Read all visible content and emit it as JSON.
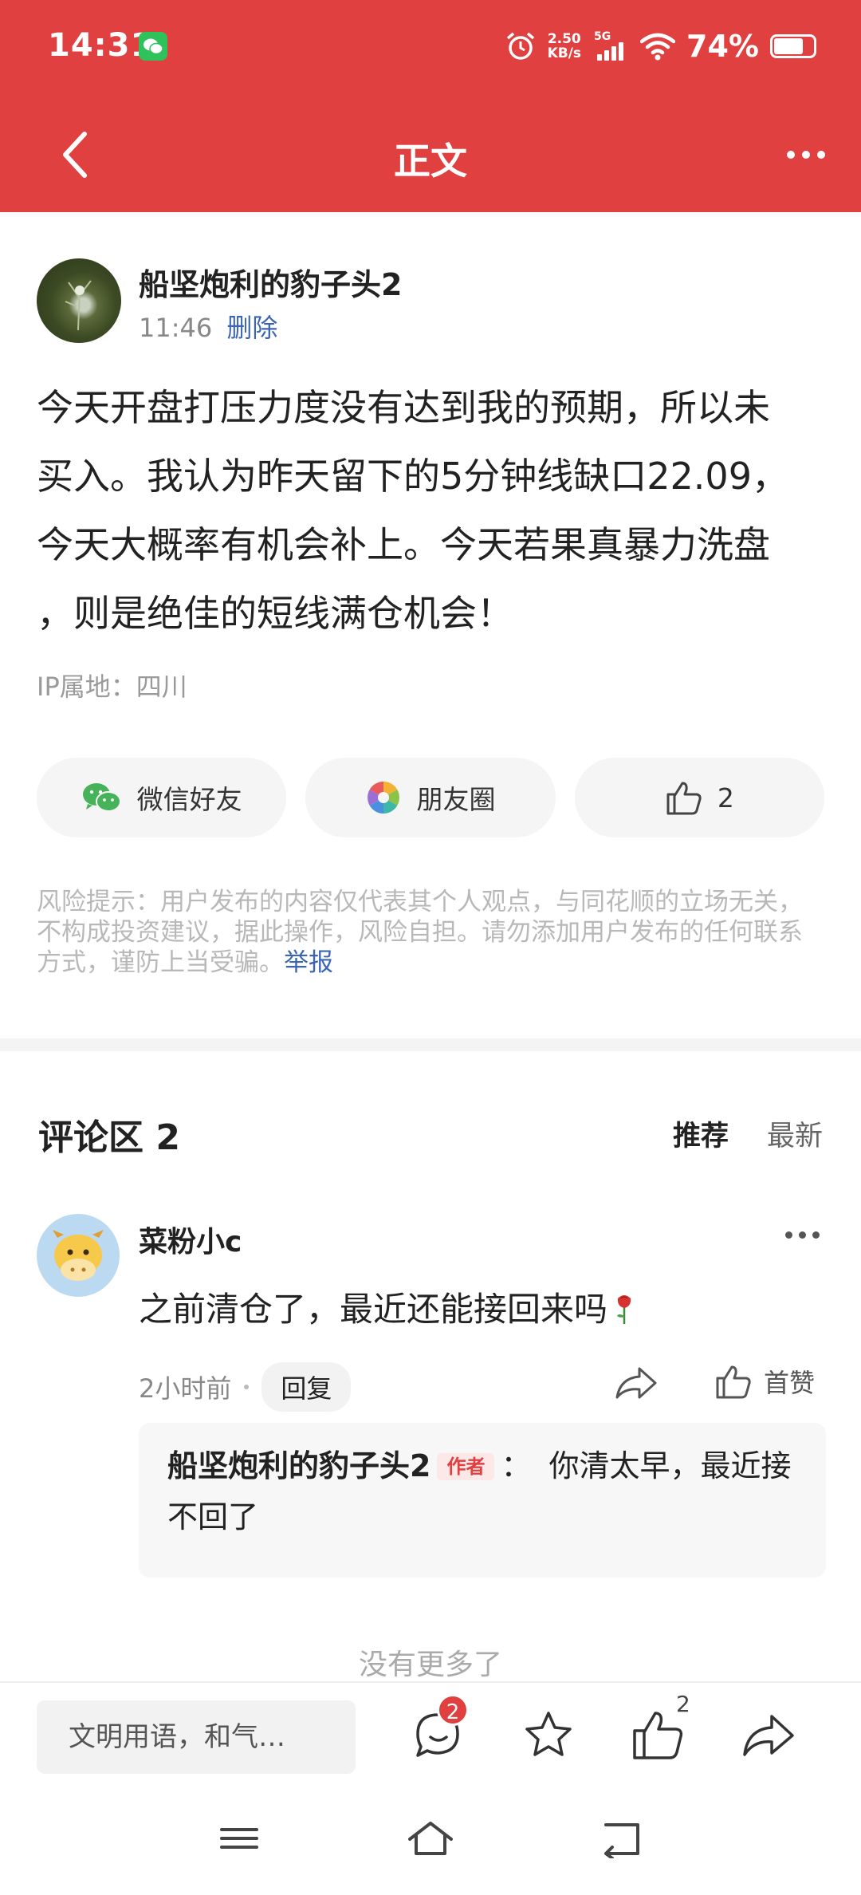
{
  "status_bar": {
    "time": "14:31",
    "net_speed_value": "2.50",
    "net_speed_unit": "KB/s",
    "network": "5G",
    "battery": "74%",
    "battery_level": 0.74
  },
  "nav": {
    "title": "正文"
  },
  "post": {
    "author": "船坚炮利的豹子头2",
    "time": "11:46",
    "delete_label": "删除",
    "content": "今天开盘打压力度没有达到我的预期，所以未\n买入。我认为昨天留下的5分钟线缺口22.09，\n今天大概率有机会补上。今天若果真暴力洗盘\n，则是绝佳的短线满仓机会！",
    "ip_location": "IP属地：四川"
  },
  "share": {
    "wechat_friend": "微信好友",
    "moments": "朋友圈",
    "like_count": "2"
  },
  "risk_notice": {
    "text": "风险提示：用户发布的内容仅代表其个人观点，与同花顺的立场无关，不构成投资建议，据此操作，风险自担。请勿添加用户发布的任何联系方式，谨防上当受骗。",
    "report_label": "举报"
  },
  "comments": {
    "title": "评论区 2",
    "sort_recommended": "推荐",
    "sort_latest": "最新",
    "items": [
      {
        "user": "菜粉小c",
        "text": "之前清仓了，最近还能接回来吗",
        "time": "2小时前",
        "reply_label": "回复",
        "like_label": "首赞",
        "reply": {
          "author": "船坚炮利的豹子头2",
          "author_tag": "作者",
          "separator": "：",
          "text": "你清太早，最近接不回了"
        }
      }
    ],
    "no_more": "没有更多了"
  },
  "bottom_bar": {
    "input_placeholder": "文明用语，和气…",
    "comment_badge": "2",
    "like_count": "2"
  },
  "colors": {
    "brand_red": "#e04040",
    "link_blue": "#3c64b4"
  }
}
